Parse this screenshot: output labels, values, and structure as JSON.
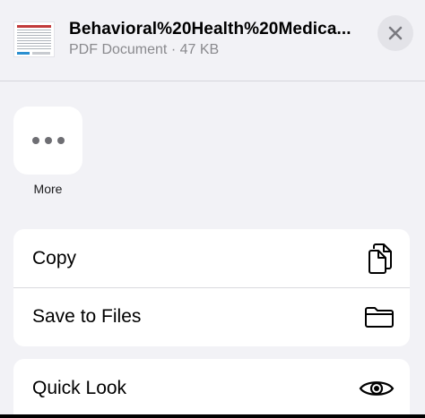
{
  "header": {
    "file_name": "Behavioral%20Health%20Medica...",
    "file_meta": "PDF Document · 47 KB",
    "close_icon": "xmark-icon"
  },
  "actions": {
    "more_label": "More",
    "more_icon": "ellipsis-icon"
  },
  "list_group_1": [
    {
      "label": "Copy",
      "icon": "copy-icon"
    },
    {
      "label": "Save to Files",
      "icon": "folder-icon"
    }
  ],
  "list_group_2": [
    {
      "label": "Quick Look",
      "icon": "eye-icon"
    }
  ]
}
